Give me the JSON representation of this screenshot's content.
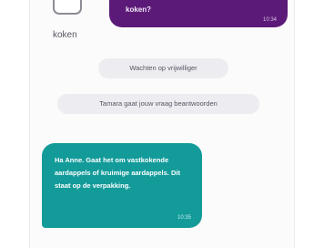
{
  "chat": {
    "attachment": {
      "caption": "koken"
    },
    "outgoing_message": {
      "text": "koken?",
      "time": "10:34"
    },
    "status_pills": [
      {
        "text": "Wachten op vrijwilliger"
      },
      {
        "text": "Tamara gaat jouw vraag beantwoorden"
      }
    ],
    "incoming_message": {
      "text": "Ha Anne. Gaat het om vastkokende aardappels of kruimige aardappels. Dit staat op de verpakking.",
      "time": "10:35"
    }
  },
  "colors": {
    "outgoing_bubble": "#5c1a78",
    "incoming_bubble": "#139b9a",
    "status_pill": "#ededf1",
    "panel_background": "#fbfbfc"
  },
  "icons": {
    "attachment": "image-thumbnail-icon"
  }
}
